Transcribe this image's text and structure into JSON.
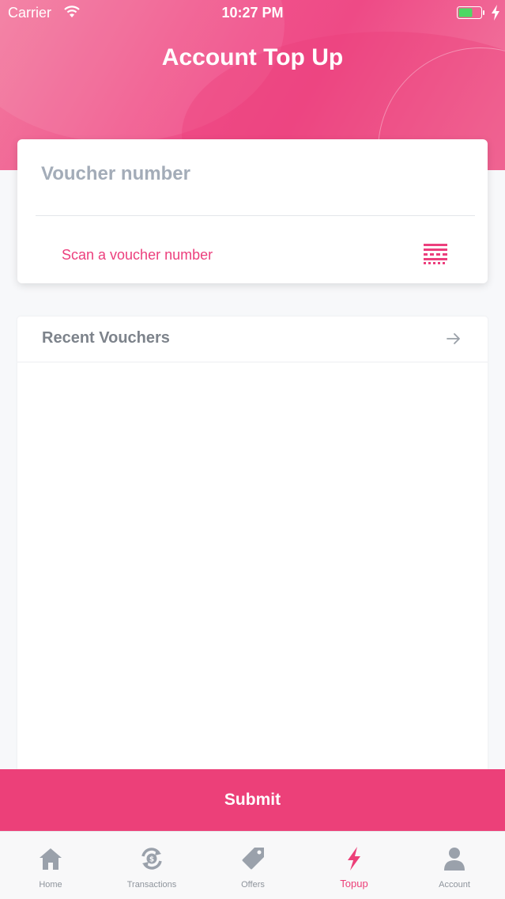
{
  "status_bar": {
    "carrier": "Carrier",
    "time": "10:27 PM",
    "battery_color": "#4cd964"
  },
  "header": {
    "title": "Account Top Up"
  },
  "voucher_card": {
    "placeholder": "Voucher number",
    "value": "",
    "scan_label": "Scan a voucher number",
    "scan_icon": "barcode-scan-icon"
  },
  "recent": {
    "title": "Recent Vouchers",
    "icon": "arrow-right-icon",
    "items": []
  },
  "submit": {
    "label": "Submit"
  },
  "tabbar": {
    "active": "Topup",
    "accent": "#ec4079",
    "items": [
      {
        "label": "Home",
        "icon": "home-icon"
      },
      {
        "label": "Transactions",
        "icon": "transactions-icon"
      },
      {
        "label": "Offers",
        "icon": "tag-icon"
      },
      {
        "label": "Topup",
        "icon": "lightning-icon"
      },
      {
        "label": "Account",
        "icon": "user-icon"
      }
    ]
  }
}
